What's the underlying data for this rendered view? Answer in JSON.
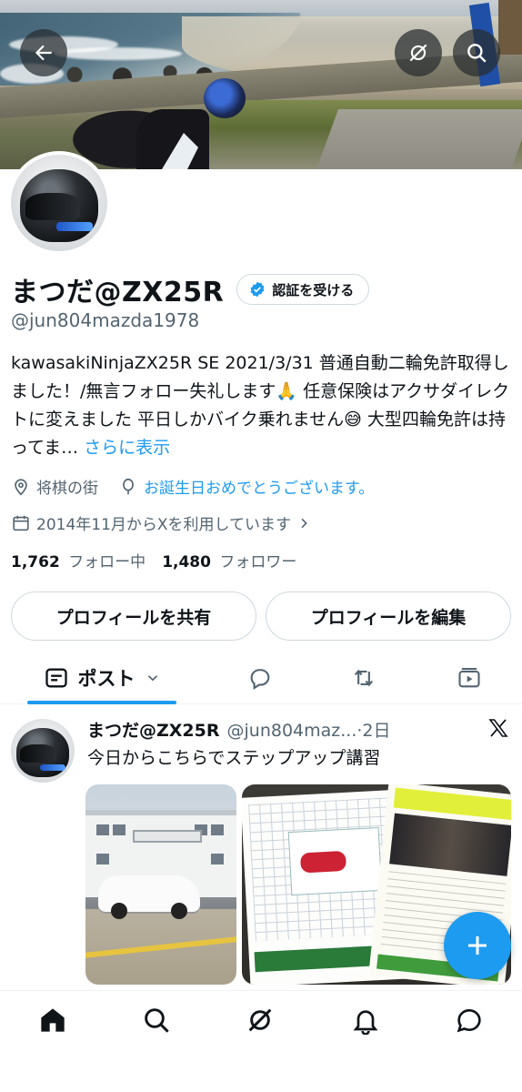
{
  "header": {
    "back_icon": "arrow-left-icon",
    "grok_icon": "grok-icon",
    "search_icon": "search-icon"
  },
  "profile": {
    "display_name": "まつだ@ZX25R",
    "verify_button": "認証を受ける",
    "handle": "@jun804mazda1978",
    "bio": "kawasakiNinjaZX25R SE 2021/3/31 普通自動二輪免許取得しました！/無言フォロー失礼します🙏 任意保険はアクサダイレクトに変えました 平日しかバイク乗れません😅 大型四輪免許は持ってま…",
    "bio_more": "さらに表示",
    "location": "将棋の街",
    "birthday": "お誕生日おめでとうございます。",
    "joined": "2014年11月からXを利用しています",
    "following_count": "1,762",
    "following_label": "フォロー中",
    "followers_count": "1,480",
    "followers_label": "フォロワー",
    "share_button": "プロフィールを共有",
    "edit_button": "プロフィールを編集"
  },
  "tabs": {
    "posts_label": "ポスト",
    "items": [
      "posts",
      "replies",
      "reposts",
      "media"
    ]
  },
  "tweet": {
    "name": "まつだ@ZX25R",
    "handle_time": "@jun804maz...·2日",
    "text": "今日からこちらでステップアップ講習"
  },
  "bottom_nav": [
    "home-icon",
    "search-icon",
    "grok-icon",
    "notifications-icon",
    "messages-icon"
  ],
  "colors": {
    "accent": "#1d9bf0",
    "secondary_text": "#536471",
    "border": "#cfd9de"
  }
}
